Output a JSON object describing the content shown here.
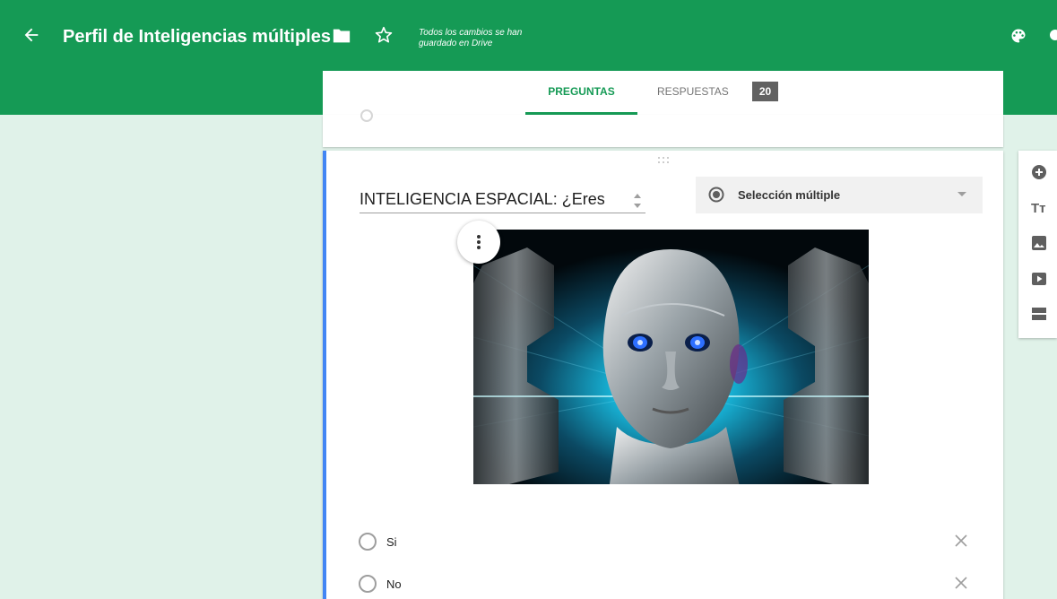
{
  "header": {
    "title": "Perfil de Inteligencias múltiples",
    "save_status": "Todos los cambios se han guardado en Drive"
  },
  "tabs": {
    "preguntas": "PREGUNTAS",
    "respuestas": "RESPUESTAS",
    "respuestas_count": "20"
  },
  "question": {
    "title": "INTELIGENCIA ESPACIAL: ¿Eres",
    "type": "Selección múltiple",
    "options": [
      {
        "label": "Si"
      },
      {
        "label": "No"
      }
    ]
  },
  "toolbar": {
    "add_icon": "add-circle-icon",
    "text_label": "Tт",
    "image_icon": "image-icon",
    "video_icon": "video-icon",
    "section_icon": "section-icon"
  },
  "colors": {
    "theme": "#159a55",
    "background": "#e0f2e9",
    "focus": "#4285f4"
  }
}
